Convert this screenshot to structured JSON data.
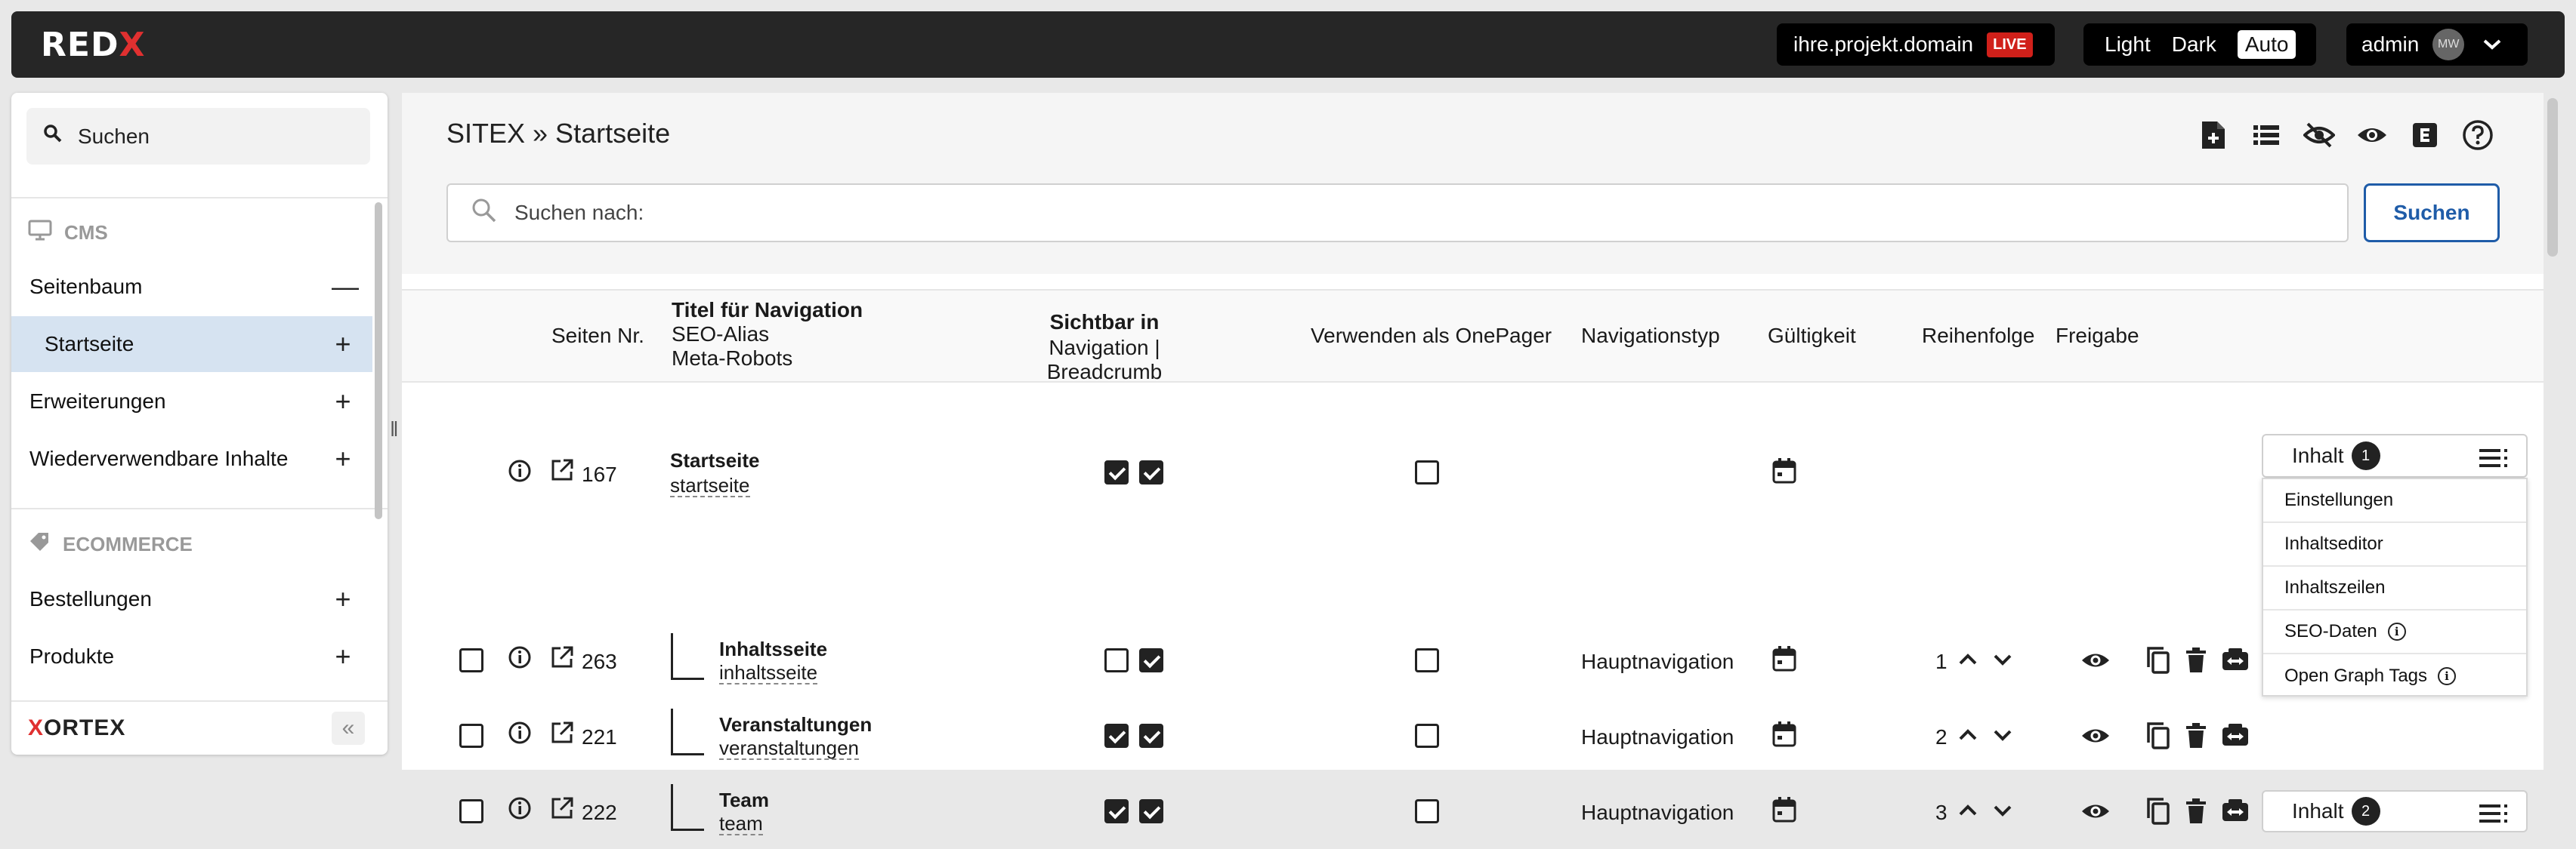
{
  "topbar": {
    "logo_main": "RED",
    "logo_accent": "X",
    "domain": "ihre.projekt.domain",
    "live_badge": "LIVE",
    "theme_options": [
      "Light",
      "Dark",
      "Auto"
    ],
    "theme_active": "Auto",
    "user": "admin",
    "avatar_initials": "MW"
  },
  "sidebar": {
    "search_label": "Suchen",
    "sections": [
      {
        "label": "CMS",
        "icon": "monitor-icon"
      },
      {
        "label": "ECOMMERCE",
        "icon": "tag-icon"
      }
    ],
    "cms_items": [
      {
        "label": "Seitenbaum",
        "sign": "—"
      },
      {
        "label": "Startseite",
        "sign": "+"
      },
      {
        "label": "Erweiterungen",
        "sign": "+"
      },
      {
        "label": "Wiederverwendbare Inhalte",
        "sign": "+"
      }
    ],
    "ecommerce_items": [
      {
        "label": "Bestellungen",
        "sign": "+"
      },
      {
        "label": "Produkte",
        "sign": "+"
      }
    ],
    "footer_logo_main": "X",
    "footer_logo_rest": "ORTEX",
    "collapse_glyph": "«"
  },
  "main": {
    "breadcrumb": "SITEX » Startseite",
    "search_placeholder": "Suchen nach:",
    "search_button": "Suchen",
    "columns": {
      "page_nr": "Seiten Nr.",
      "title_line1": "Titel für Navigation",
      "title_line2": "SEO-Alias",
      "title_line3": "Meta-Robots",
      "visible_line1": "Sichtbar in",
      "visible_line2": "Navigation | Breadcrumb",
      "onepager": "Verwenden als OnePager",
      "navtype": "Navigationstyp",
      "validity": "Gültigkeit",
      "order": "Reihenfolge",
      "release": "Freigabe"
    },
    "rows": [
      {
        "nr": "167",
        "title": "Startseite",
        "alias": "startseite",
        "nav": true,
        "breadcrumb": true,
        "onepager": false,
        "navtype": "",
        "order": ""
      },
      {
        "nr": "263",
        "title": "Inhaltsseite",
        "alias": "inhaltsseite",
        "nav": false,
        "breadcrumb": true,
        "onepager": false,
        "navtype": "Hauptnavigation",
        "order": "1"
      },
      {
        "nr": "221",
        "title": "Veranstaltungen",
        "alias": "veranstaltungen",
        "nav": true,
        "breadcrumb": true,
        "onepager": false,
        "navtype": "Hauptnavigation",
        "order": "2"
      },
      {
        "nr": "222",
        "title": "Team",
        "alias": "team",
        "nav": true,
        "breadcrumb": true,
        "onepager": false,
        "navtype": "Hauptnavigation",
        "order": "3"
      }
    ],
    "dropdown1": {
      "label": "Inhalt",
      "count": "1"
    },
    "dropdown2": {
      "label": "Inhalt",
      "count": "2"
    },
    "menu_items": [
      "Einstellungen",
      "Inhaltseditor",
      "Inhaltszeilen",
      "SEO-Daten",
      "Open Graph Tags"
    ]
  }
}
